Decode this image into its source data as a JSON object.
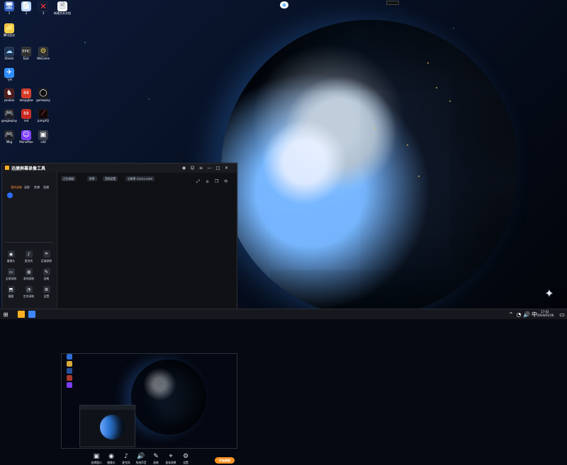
{
  "desktop": {
    "icons": [
      {
        "label": "1",
        "icon": "computer-icon"
      },
      {
        "label": "2",
        "icon": "document-icon"
      },
      {
        "label": "3",
        "icon": "close-icon"
      },
      {
        "label": "新建文本文档",
        "icon": "text-file-icon"
      },
      {
        "label": "腾讯会议",
        "icon": "folder-icon"
      },
      {
        "label": "Steam",
        "icon": "steam-icon"
      },
      {
        "label": "Epic",
        "icon": "epic-icon"
      },
      {
        "label": "WeGame",
        "icon": "wegame-icon"
      },
      {
        "label": "飞书",
        "icon": "bird-icon"
      },
      {
        "label": "youban",
        "icon": "app-icon"
      },
      {
        "label": "deepglow",
        "icon": "game-icon"
      },
      {
        "label": "gameplay",
        "icon": "search-icon"
      },
      {
        "label": "googleplay",
        "icon": "controller-icon"
      },
      {
        "label": "red",
        "icon": "game-icon-2"
      },
      {
        "label": "JumpXQ",
        "icon": "pen-icon"
      },
      {
        "label": "Mbg",
        "icon": "controller-icon-2"
      },
      {
        "label": "MonoMoo",
        "icon": "avatar-icon"
      },
      {
        "label": "cdd",
        "icon": "image-icon"
      }
    ]
  },
  "recorder": {
    "title": "迅捷屏幕录像工具",
    "top_tabs": [
      "我的录制",
      "录屏",
      "剪辑",
      "直播"
    ],
    "left_tools": [
      {
        "label": "摄像头",
        "icon": "camera-icon"
      },
      {
        "label": "麦克风",
        "icon": "mic-icon"
      },
      {
        "label": "区域录制",
        "icon": "crop-icon"
      },
      {
        "label": "全屏录制",
        "icon": "monitor-icon"
      },
      {
        "label": "游戏录制",
        "icon": "gamepad-icon"
      },
      {
        "label": "画笔",
        "icon": "brush-icon"
      },
      {
        "label": "截图",
        "icon": "screenshot-icon"
      },
      {
        "label": "定时录制",
        "icon": "clock-icon"
      },
      {
        "label": "设置",
        "icon": "settings-icon"
      }
    ],
    "stage_chips": [
      "正在录制",
      "帧率",
      "音频设置",
      "分辨率 1920×1080"
    ],
    "bottom_tools": [
      {
        "label": "选择窗口",
        "icon": "window-icon"
      },
      {
        "label": "摄像头",
        "icon": "camera-icon"
      },
      {
        "label": "麦克风",
        "icon": "mic-icon"
      },
      {
        "label": "系统声音",
        "icon": "speaker-icon"
      },
      {
        "label": "画笔",
        "icon": "brush-icon"
      },
      {
        "label": "鼠标效果",
        "icon": "cursor-icon"
      },
      {
        "label": "设置",
        "icon": "settings-icon"
      }
    ],
    "record_label": "开始录制"
  },
  "taskbar": {
    "time": "17:02",
    "date": "2024/01/18",
    "lang": "中"
  }
}
